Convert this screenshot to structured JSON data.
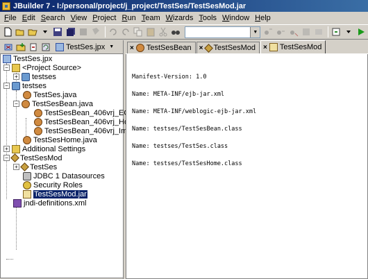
{
  "window": {
    "title": "JBuilder 7 - I:/personal/project/j_project/TestSes/TestSesMod.jar"
  },
  "menu": [
    {
      "mnemonic": "F",
      "rest": "ile"
    },
    {
      "mnemonic": "E",
      "rest": "dit"
    },
    {
      "mnemonic": "S",
      "rest": "earch"
    },
    {
      "mnemonic": "V",
      "rest": "iew"
    },
    {
      "mnemonic": "P",
      "rest": "roject"
    },
    {
      "mnemonic": "R",
      "rest": "un"
    },
    {
      "mnemonic": "T",
      "rest": "eam"
    },
    {
      "mnemonic": "W",
      "rest": "izards"
    },
    {
      "mnemonic": "T",
      "rest": "ools"
    },
    {
      "mnemonic": "W",
      "rest": "indow"
    },
    {
      "mnemonic": "H",
      "rest": "elp"
    }
  ],
  "search": {
    "value": ""
  },
  "project": {
    "name": "TestSes.jpx"
  },
  "tree": {
    "root": "TestSes.jpx",
    "project_source": "<Project Source>",
    "testses_pkg_1": "testses",
    "testses_pkg_2": "testses",
    "testses_java": "TestSes.java",
    "testsesbean_java": "TestSesBean.java",
    "bean_ejb": "TestSesBean_406vrj_EO",
    "bean_home": "TestSesBean_406vrj_Ho",
    "bean_impl": "TestSesBean_406vrj_Im",
    "testseshome_java": "TestSesHome.java",
    "additional_settings": "Additional Settings",
    "testsesmod": "TestSesMod",
    "testses_ejb": "TestSes",
    "jdbc": "JDBC 1 Datasources",
    "security_roles": "Security Roles",
    "testsesmod_jar": "TestSesMod.jar",
    "jndi": "jndi-definitions.xml"
  },
  "tabs": [
    {
      "label": "TestSesBean"
    },
    {
      "label": "TestSesMod"
    },
    {
      "label": "TestSesMod"
    }
  ],
  "editor": {
    "lines": [
      "Manifest-Version: 1.0",
      "Name: META-INF/ejb-jar.xml",
      "Name: META-INF/weblogic-ejb-jar.xml",
      "Name: testses/TestSesBean.class",
      "Name: testses/TestSes.class",
      "Name: testses/TestSesHome.class"
    ]
  }
}
